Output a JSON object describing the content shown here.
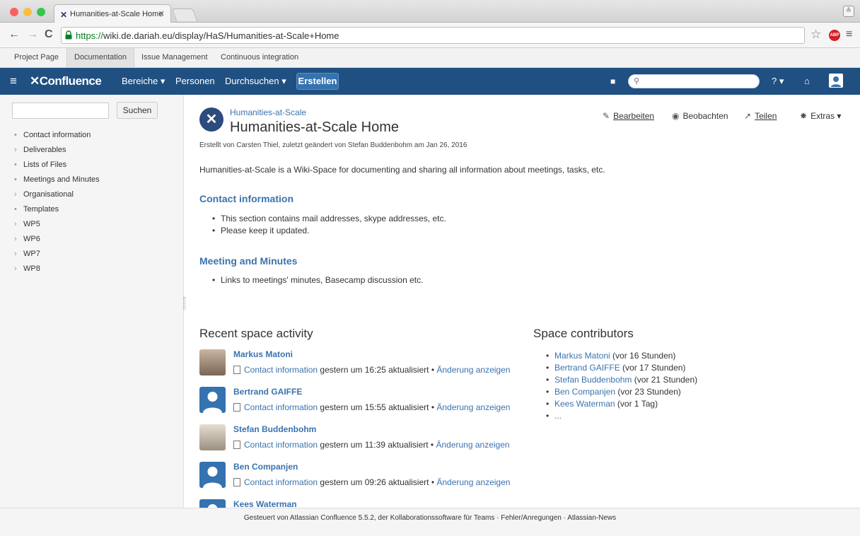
{
  "browser": {
    "tab_title": "Humanities-at-Scale Home",
    "url_https": "https://",
    "url_rest": "wiki.de.dariah.eu/display/HaS/Humanities-at-Scale+Home",
    "abp_label": "ABP"
  },
  "bookmarks": [
    "Project Page",
    "Documentation",
    "Issue Management",
    "Continuous integration"
  ],
  "header": {
    "logo": "Confluence",
    "bereiche": "Bereiche ▾",
    "personen": "Personen",
    "durchsuchen": "Durchsuchen ▾",
    "erstellen": "Erstellen",
    "help": "? ▾"
  },
  "sidebar": {
    "search_button": "Suchen",
    "items": [
      {
        "marker": "•",
        "label": "Contact information"
      },
      {
        "marker": "›",
        "label": "Deliverables"
      },
      {
        "marker": "•",
        "label": "Lists of Files"
      },
      {
        "marker": "•",
        "label": "Meetings and Minutes"
      },
      {
        "marker": "›",
        "label": "Organisational"
      },
      {
        "marker": "•",
        "label": "Templates"
      },
      {
        "marker": "›",
        "label": "WP5"
      },
      {
        "marker": "›",
        "label": "WP6"
      },
      {
        "marker": "›",
        "label": "WP7"
      },
      {
        "marker": "›",
        "label": "WP8"
      }
    ]
  },
  "page": {
    "breadcrumb": "Humanities-at-Scale",
    "title": "Humanities-at-Scale Home",
    "meta": "Erstellt von Carsten Thiel, zuletzt geändert von Stefan Buddenbohm am Jan 26, 2016",
    "actions": {
      "edit": "Bearbeiten",
      "watch": "Beobachten",
      "share": "Teilen",
      "extras": "Extras ▾"
    },
    "intro": "Humanities-at-Scale is a Wiki-Space for documenting and sharing all information about meetings, tasks, etc.",
    "sections": [
      {
        "heading": "Contact information",
        "bullets": [
          "This section contains mail addresses, skype addresses, etc.",
          "Please keep it updated."
        ]
      },
      {
        "heading": "Meeting and Minutes",
        "bullets": [
          "Links to meetings' minutes, Basecamp discussion etc."
        ]
      }
    ]
  },
  "activity": {
    "title": "Recent space activity",
    "link_page": "Contact information",
    "change_link": "Änderung anzeigen",
    "entries": [
      {
        "name": "Markus Matoni",
        "text": " gestern um 16:25 aktualisiert • "
      },
      {
        "name": "Bertrand GAIFFE",
        "text": " gestern um 15:55 aktualisiert • "
      },
      {
        "name": "Stefan Buddenbohm",
        "text": " gestern um 11:39 aktualisiert • "
      },
      {
        "name": "Ben Companjen",
        "text": " gestern um 09:26 aktualisiert • "
      },
      {
        "name": "Kees Waterman",
        "text": ""
      }
    ]
  },
  "contributors": {
    "title": "Space contributors",
    "items": [
      {
        "name": "Markus Matoni",
        "when": " (vor 16 Stunden)"
      },
      {
        "name": "Bertrand GAIFFE",
        "when": " (vor 17 Stunden)"
      },
      {
        "name": "Stefan Buddenbohm",
        "when": " (vor 21 Stunden)"
      },
      {
        "name": "Ben Companjen",
        "when": " (vor 23 Stunden)"
      },
      {
        "name": "Kees Waterman",
        "when": " (vor 1 Tag)"
      },
      {
        "name": "...",
        "when": ""
      }
    ]
  },
  "footer": {
    "powered": "Gesteuert von Atlassian Confluence 5.5.2, der Kollaborationssoftware für Teams",
    "sep": " · ",
    "bugs": "Fehler/Anregungen",
    "news": "Atlassian-News"
  },
  "colors": {
    "header": "#205081",
    "link": "#3b73af",
    "create": "#3572b0"
  }
}
